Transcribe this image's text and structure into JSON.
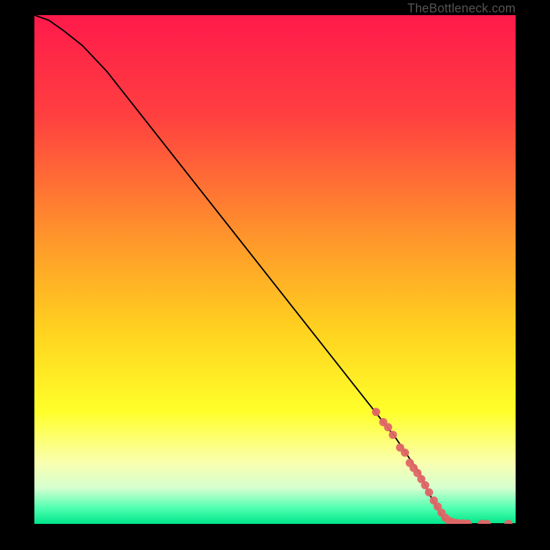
{
  "watermark": "TheBottleneck.com",
  "chart_data": {
    "type": "line",
    "title": "",
    "xlabel": "",
    "ylabel": "",
    "xlim": [
      0,
      100
    ],
    "ylim": [
      0,
      100
    ],
    "grid": false,
    "legend": false,
    "series": [
      {
        "name": "curve",
        "x": [
          0,
          3,
          6,
          10,
          15,
          20,
          30,
          40,
          50,
          60,
          70,
          75,
          80,
          82,
          85,
          90,
          95,
          100
        ],
        "y": [
          100,
          99,
          97,
          94,
          89,
          83,
          71,
          59,
          47,
          35,
          23,
          17,
          10,
          6,
          1,
          0,
          0,
          0
        ]
      }
    ],
    "scatter": {
      "name": "points",
      "color": "#e06666",
      "x": [
        71,
        72.5,
        73.5,
        74.5,
        76,
        77,
        78,
        78.8,
        79.6,
        80.4,
        81.2,
        82,
        83,
        83.8,
        84.6,
        85.4,
        86.2,
        87,
        88,
        89,
        90,
        93,
        94,
        98.5
      ],
      "y": [
        22,
        20,
        19,
        17.5,
        15,
        14,
        12,
        11,
        10,
        8.8,
        7.6,
        6.2,
        4.6,
        3.4,
        2.2,
        1.2,
        0.6,
        0.3,
        0.15,
        0.1,
        0.05,
        0,
        0,
        0
      ]
    },
    "gradient_stops": [
      {
        "pct": 0,
        "color": "#ff1a4b"
      },
      {
        "pct": 20,
        "color": "#ff4040"
      },
      {
        "pct": 45,
        "color": "#ff9a2a"
      },
      {
        "pct": 62,
        "color": "#ffd21f"
      },
      {
        "pct": 78,
        "color": "#ffff2a"
      },
      {
        "pct": 88,
        "color": "#faffb0"
      },
      {
        "pct": 93,
        "color": "#d4ffd0"
      },
      {
        "pct": 97,
        "color": "#4dffb0"
      },
      {
        "pct": 100,
        "color": "#00e58a"
      }
    ]
  }
}
